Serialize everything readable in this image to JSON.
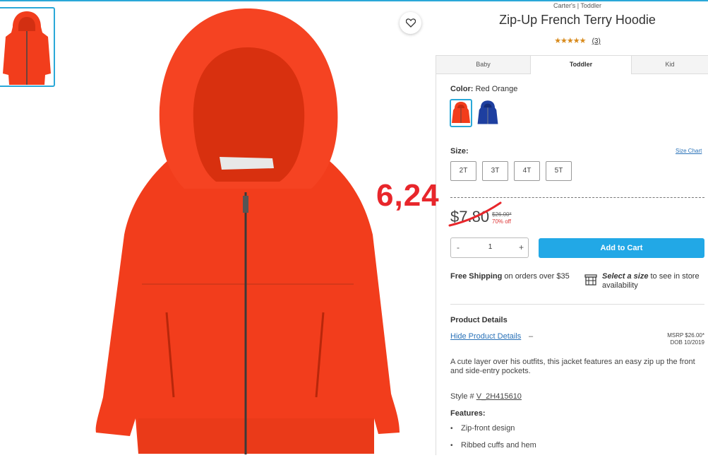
{
  "product": {
    "brand_line": "Carter's | Toddler",
    "title": "Zip-Up French Terry Hoodie",
    "rating": 4.5,
    "stars_icon": "★★★★★",
    "rating_count": "(3)"
  },
  "tabs": [
    {
      "label": "Baby",
      "active": false
    },
    {
      "label": "Toddler",
      "active": true
    },
    {
      "label": "Kid",
      "active": false
    }
  ],
  "color": {
    "label": "Color:",
    "value": "Red Orange",
    "swatches": [
      {
        "name": "red-orange",
        "hex": "#f23d1c",
        "selected": true
      },
      {
        "name": "navy-blue",
        "hex": "#1e3fa0",
        "selected": false
      }
    ]
  },
  "size": {
    "label": "Size:",
    "chart_link": "Size Chart",
    "options": [
      "2T",
      "3T",
      "4T",
      "5T"
    ]
  },
  "annotation": {
    "text": "6,24",
    "color": "#e8262b"
  },
  "price": {
    "current": "$7.80",
    "msrp": "$26.00*",
    "discount": "70% off"
  },
  "quantity": {
    "minus": "-",
    "value": "1",
    "plus": "+"
  },
  "cart": {
    "add_label": "Add to Cart"
  },
  "shipping": {
    "bold": "Free Shipping",
    "rest": " on orders over $35"
  },
  "store": {
    "bold": "Select a size",
    "rest": " to see in store availability",
    "icon": "store-icon"
  },
  "details": {
    "heading": "Product Details",
    "hide_link": "Hide Product Details",
    "hide_dash": "–",
    "msrp_line": "MSRP $26.00*",
    "dob_line": "DOB 10/2019",
    "description": "A cute layer over his outfits, this jacket features an easy zip up the front and side-entry pockets.",
    "style_prefix": "Style #",
    "style_number": "V_2H415610",
    "features_heading": "Features:",
    "features": [
      "Zip-front design",
      "Ribbed cuffs and hem"
    ]
  },
  "colors": {
    "accent": "#22a8e6",
    "link": "#2a72b8",
    "sale": "#d33333",
    "hoodie": "#f23d1c"
  }
}
